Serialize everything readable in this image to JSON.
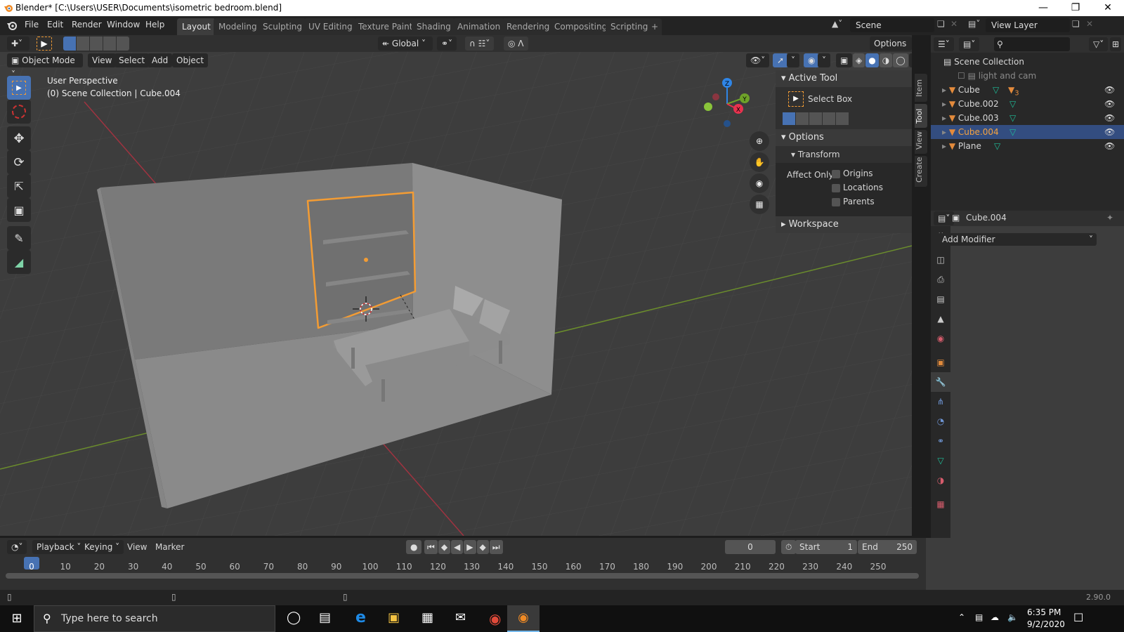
{
  "window": {
    "title": "Blender* [C:\\Users\\USER\\Documents\\isometric bedroom.blend]",
    "controls": [
      "minimize",
      "restore",
      "close"
    ]
  },
  "menu": [
    "File",
    "Edit",
    "Render",
    "Window",
    "Help"
  ],
  "workspaces": [
    {
      "label": "Layout",
      "active": true
    },
    {
      "label": "Modeling"
    },
    {
      "label": "Sculpting"
    },
    {
      "label": "UV Editing"
    },
    {
      "label": "Texture Paint"
    },
    {
      "label": "Shading"
    },
    {
      "label": "Animation"
    },
    {
      "label": "Rendering"
    },
    {
      "label": "Compositing"
    },
    {
      "label": "Scripting"
    }
  ],
  "add_workspace": "+",
  "scene": {
    "name": "Scene",
    "view_layer": "View Layer"
  },
  "tool_header": {
    "orientation": "Global",
    "options_label": "Options"
  },
  "viewport_header": {
    "mode": "Object Mode",
    "menus": [
      "View",
      "Select",
      "Add",
      "Object"
    ]
  },
  "viewport": {
    "perspective_label": "User Perspective",
    "context_label": "(0) Scene Collection | Cube.004",
    "axes": {
      "x": "X",
      "y": "Y",
      "z": "Z"
    },
    "colors": {
      "x": "#e8324e",
      "y": "#6ea229",
      "z": "#2f85e6",
      "selection": "#f39c34"
    }
  },
  "toolbar": [
    "select-box",
    "cursor",
    "move",
    "rotate",
    "scale",
    "transform",
    "annotate",
    "measure"
  ],
  "npanel": {
    "tabs": [
      "Item",
      "Tool",
      "View",
      "Create"
    ],
    "active_tab": "Tool",
    "active_tool": {
      "header": "Active Tool",
      "tool_name": "Select Box"
    },
    "options": {
      "header": "Options",
      "transform_header": "Transform",
      "affect_only_label": "Affect Only",
      "checkboxes": [
        {
          "label": "Origins",
          "checked": false
        },
        {
          "label": "Locations",
          "checked": false
        },
        {
          "label": "Parents",
          "checked": false
        }
      ]
    },
    "workspace": {
      "header": "Workspace"
    }
  },
  "outliner": {
    "search_placeholder": "",
    "root": "Scene Collection",
    "items": [
      {
        "name": "light and cam",
        "type": "collection",
        "excluded": true
      },
      {
        "name": "Cube",
        "type": "mesh",
        "badge": "3",
        "selected": false
      },
      {
        "name": "Cube.002",
        "type": "mesh",
        "selected": false
      },
      {
        "name": "Cube.003",
        "type": "mesh",
        "selected": false
      },
      {
        "name": "Cube.004",
        "type": "mesh",
        "selected": true
      },
      {
        "name": "Plane",
        "type": "mesh",
        "selected": false
      }
    ]
  },
  "properties": {
    "object_name": "Cube.004",
    "active_tab": "modifiers",
    "tabs": [
      "tool",
      "render",
      "output",
      "view-layer",
      "scene",
      "world",
      "object",
      "modifiers",
      "particles",
      "physics",
      "constraints",
      "data",
      "material",
      "texture"
    ],
    "add_modifier_label": "Add Modifier"
  },
  "timeline": {
    "menus": [
      "Playback",
      "Keying",
      "View",
      "Marker"
    ],
    "current_frame": "0",
    "start_label": "Start",
    "start": "1",
    "end_label": "End",
    "end": "250",
    "ticks": [
      "0",
      "10",
      "20",
      "30",
      "40",
      "50",
      "60",
      "70",
      "80",
      "90",
      "100",
      "110",
      "120",
      "130",
      "140",
      "150",
      "160",
      "170",
      "180",
      "190",
      "200",
      "210",
      "220",
      "230",
      "240",
      "250"
    ]
  },
  "status": {
    "version": "2.90.0"
  },
  "taskbar": {
    "search_placeholder": "Type here to search",
    "time": "6:35 PM",
    "date": "9/2/2020"
  }
}
